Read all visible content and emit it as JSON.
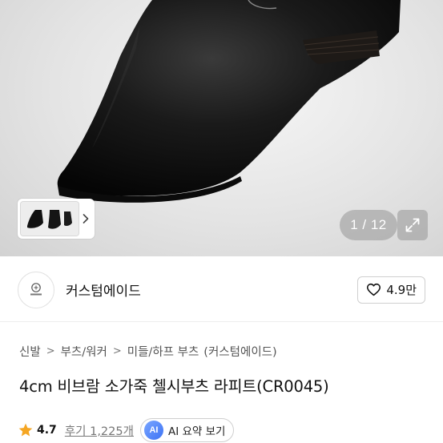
{
  "gallery": {
    "counter": "1 / 12",
    "expand_icon": "expand-arrows-icon",
    "thumb_next_icon": "chevron-right-icon"
  },
  "seller": {
    "logo_icon": "brand-logo-icon",
    "name": "커스텀에이드",
    "likes": "4.9만",
    "like_icon": "heart-outline-icon"
  },
  "breadcrumb": [
    "신발",
    "부츠/워커",
    "미들/하프 부츠",
    "(커스텀에이드)"
  ],
  "breadcrumb_separator": ">",
  "product": {
    "title": "4cm 비브람 소가죽 첼시부츠 라피트(CR0045)"
  },
  "rating": {
    "star_color": "#f5a623",
    "value": "4.7",
    "reviews": "후기 1,225개",
    "ai_badge": "AI",
    "ai_label": "AI 요약 보기"
  }
}
